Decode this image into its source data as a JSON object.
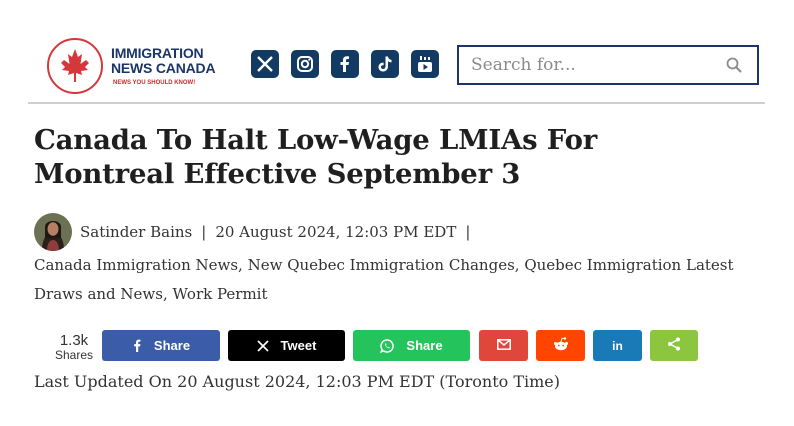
{
  "logo": {
    "line1": "IMMIGRATION",
    "line2": "NEWS CANADA",
    "tagline": "NEWS YOU SHOULD KNOW!",
    "brand_red": "#d5383b",
    "brand_navy": "#1c3568"
  },
  "socials": [
    {
      "name": "x-icon"
    },
    {
      "name": "instagram-icon"
    },
    {
      "name": "facebook-icon"
    },
    {
      "name": "tiktok-icon"
    },
    {
      "name": "youtube-icon"
    }
  ],
  "search": {
    "placeholder": "Search for..."
  },
  "article": {
    "title": "Canada To Halt Low-Wage LMIAs For Montreal Effective September 3",
    "author": "Satinder Bains",
    "separator": "|",
    "date": "20 August 2024, 12:03 PM EDT",
    "categories": [
      "Canada Immigration News",
      "New Quebec Immigration Changes",
      "Quebec Immigration Latest Draws and News",
      "Work Permit"
    ],
    "category_separator": ", ",
    "last_updated": "Last Updated On 20 August 2024, 12:03 PM EDT (Toronto Time)"
  },
  "share": {
    "count": "1.3k",
    "count_label": "Shares",
    "buttons": [
      {
        "icon": "facebook-icon",
        "label": "Share",
        "color": "#3b5ca8"
      },
      {
        "icon": "x-icon",
        "label": "Tweet",
        "color": "#000000"
      },
      {
        "icon": "whatsapp-icon",
        "label": "Share",
        "color": "#25c35b"
      },
      {
        "icon": "gmail-icon",
        "label": "",
        "color": "#e0473b"
      },
      {
        "icon": "reddit-icon",
        "label": "",
        "color": "#ff4500"
      },
      {
        "icon": "linkedin-icon",
        "label": "",
        "color": "#1a7ab8"
      },
      {
        "icon": "share-icon",
        "label": "",
        "color": "#8cc63e"
      }
    ]
  }
}
